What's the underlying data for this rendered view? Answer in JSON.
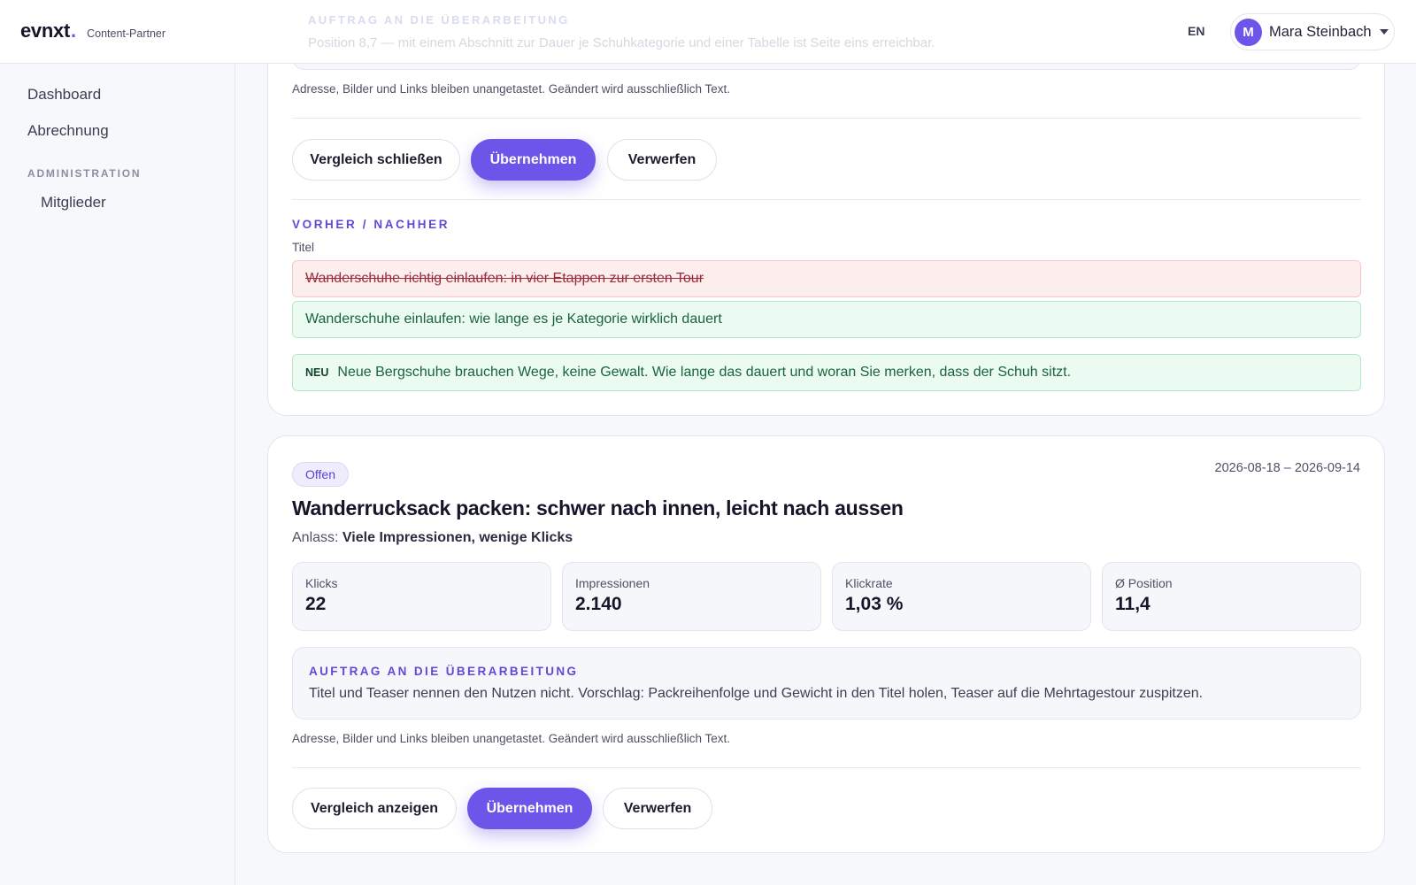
{
  "header": {
    "brand": "evnxt",
    "brand_dot": ".",
    "brand_subtitle": "Content-Partner",
    "ghost_heading": "AUFTRAG AN DIE ÜBERARBEITUNG",
    "ghost_text": "Position 8,7 — mit einem Abschnitt zur Dauer je Schuhkategorie und einer Tabelle ist Seite eins erreichbar.",
    "language": "EN",
    "user": {
      "initial": "M",
      "name": "Mara Steinbach"
    }
  },
  "sidebar": {
    "items": [
      {
        "label": "Dashboard"
      },
      {
        "label": "Abrechnung"
      }
    ],
    "section_label": "ADMINISTRATION",
    "admin_items": [
      {
        "label": "Mitglieder"
      }
    ]
  },
  "card_top": {
    "note": "Adresse, Bilder und Links bleiben unangetastet. Geändert wird ausschließlich Text.",
    "buttons": {
      "compare": "Vergleich schließen",
      "accept": "Übernehmen",
      "discard": "Verwerfen"
    },
    "diff_label": "VORHER / NACHHER",
    "field_label": "Titel",
    "old_title": "Wanderschuhe richtig einlaufen: in vier Etappen zur ersten Tour",
    "new_title": "Wanderschuhe einlaufen: wie lange es je Kategorie wirklich dauert",
    "new_badge": "NEU",
    "new_teaser": "Neue Bergschuhe brauchen Wege, keine Gewalt. Wie lange das dauert und woran Sie merken, dass der Schuh sitzt."
  },
  "card_bottom": {
    "status": "Offen",
    "date_range": "2026-08-18 – 2026-09-14",
    "title": "Wanderrucksack packen: schwer nach innen, leicht nach aussen",
    "reason_label": "Anlass:",
    "reason_value": "Viele Impressionen, wenige Klicks",
    "metrics": [
      {
        "label": "Klicks",
        "value": "22"
      },
      {
        "label": "Impressionen",
        "value": "2.140"
      },
      {
        "label": "Klickrate",
        "value": "1,03 %"
      },
      {
        "label": "Ø Position",
        "value": "11,4"
      }
    ],
    "brief_heading": "AUFTRAG AN DIE ÜBERARBEITUNG",
    "brief_text": "Titel und Teaser nennen den Nutzen nicht. Vorschlag: Packreihenfolge und Gewicht in den Titel holen, Teaser auf die Mehrtagestour zuspitzen.",
    "note": "Adresse, Bilder und Links bleiben unangetastet. Geändert wird ausschließlich Text.",
    "buttons": {
      "compare": "Vergleich anzeigen",
      "accept": "Übernehmen",
      "discard": "Verwerfen"
    }
  },
  "colors": {
    "accent": "#6c55e8",
    "removed_bg": "#fdeeee",
    "added_bg": "#ecfbf1"
  }
}
